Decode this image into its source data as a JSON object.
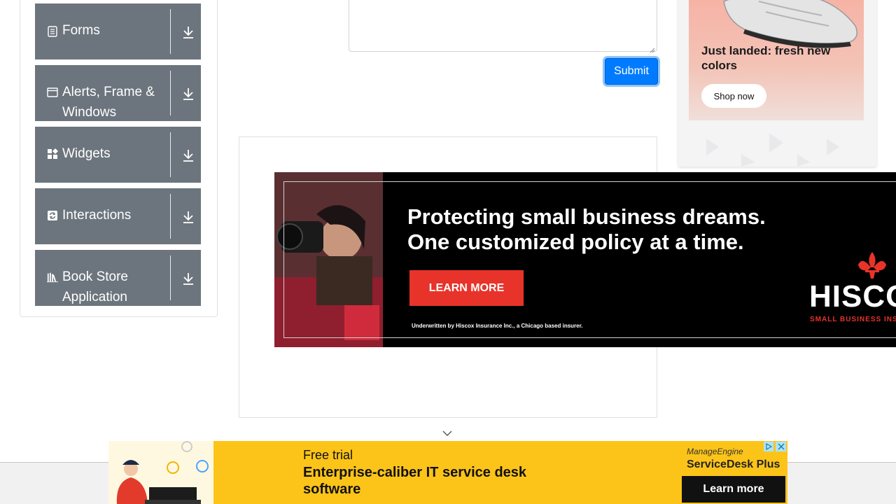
{
  "sidebar": {
    "groups": [
      {
        "label": "Forms",
        "icon": "form-icon"
      },
      {
        "label": "Alerts, Frame & Windows",
        "icon": "window-icon"
      },
      {
        "label": "Widgets",
        "icon": "widgets-icon"
      },
      {
        "label": "Interactions",
        "icon": "interactions-icon"
      },
      {
        "label": "Book Store Application",
        "icon": "books-icon"
      }
    ]
  },
  "form": {
    "submit_label": "Submit"
  },
  "right_ad": {
    "headline": "Just landed: fresh new colors",
    "cta": "Shop now"
  },
  "banner_ad": {
    "headline_line1": "Protecting small business dreams.",
    "headline_line2": "One customized policy at a time.",
    "cta": "LEARN MORE",
    "fine_print": "Underwritten by Hiscox Insurance Inc., a Chicago based insurer.",
    "logo_text": "HISCOX",
    "logo_sub": "SMALL BUSINESS INSURANCE",
    "accent": "#e8332a"
  },
  "bottom_ad": {
    "line1": "Free trial",
    "line2": "Enterprise-caliber IT service desk software",
    "brand_top": "ManageEngine",
    "brand_name": "ServiceDesk Plus",
    "cta": "Learn more",
    "bg_color": "#fcc419"
  },
  "icons": {
    "download": "download-icon",
    "chevron": "chevron-down-icon"
  }
}
